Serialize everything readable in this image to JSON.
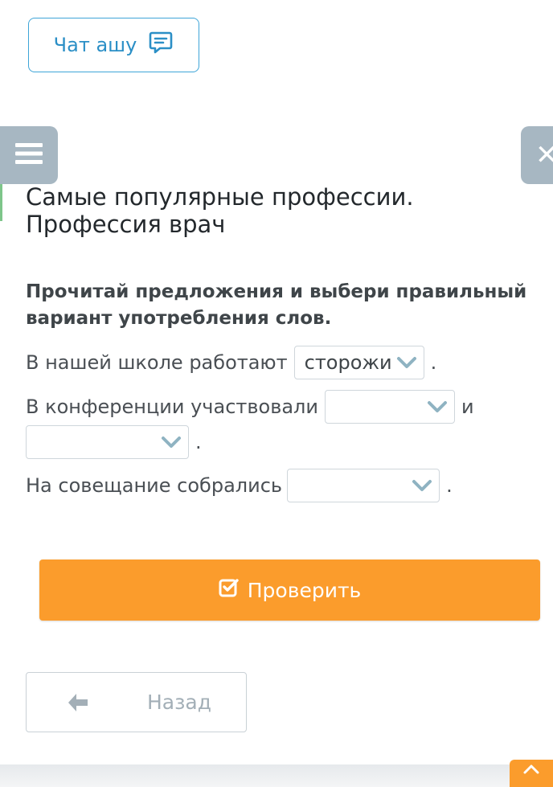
{
  "chat": {
    "label": "Чат ашу",
    "icon": "chat-bubble-icon"
  },
  "nav": {
    "menu_icon": "hamburger-menu-icon",
    "close_icon": "close-icon",
    "close_glyph": "✕"
  },
  "title": "Самые популярные профессии. Профессия врач",
  "instruction": "Прочитай предложения и выбери правильный вариант употребления слов.",
  "sentences": [
    {
      "text": "В нашей школе работают",
      "dropdown_value": "сторожи",
      "end": "."
    },
    {
      "text": "В конференции участвовали",
      "dropdown_value": "",
      "middle": "и",
      "dropdown2_value": "",
      "end": "."
    },
    {
      "text": "На совещание собрались",
      "dropdown_value": "",
      "end": "."
    }
  ],
  "actions": {
    "check_label": "Проверить",
    "check_icon": "check-square-icon",
    "back_label": "Назад",
    "back_icon": "arrow-left-icon",
    "scroll_top_icon": "chevron-up-icon"
  },
  "colors": {
    "accent": "#fb9c2c",
    "link": "#2b8fc6",
    "dropdown_chevron": "#8fb3c2",
    "side_tab": "#a7b7c2"
  }
}
